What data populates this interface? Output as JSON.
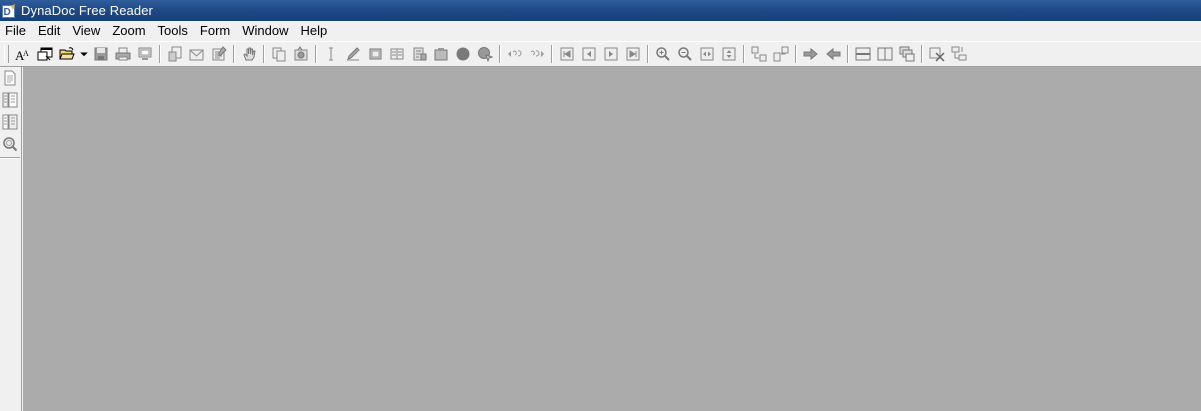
{
  "window": {
    "title": "DynaDoc Free Reader"
  },
  "menu": [
    "File",
    "Edit",
    "View",
    "Zoom",
    "Tools",
    "Form",
    "Window",
    "Help"
  ],
  "toolbar": {
    "font_button_glyph": "AA"
  },
  "colors": {
    "titlebar": "#1f4a87",
    "workspace": "#ababab",
    "chrome": "#f0f0f0",
    "icon_gray": "#8a8a8a"
  }
}
